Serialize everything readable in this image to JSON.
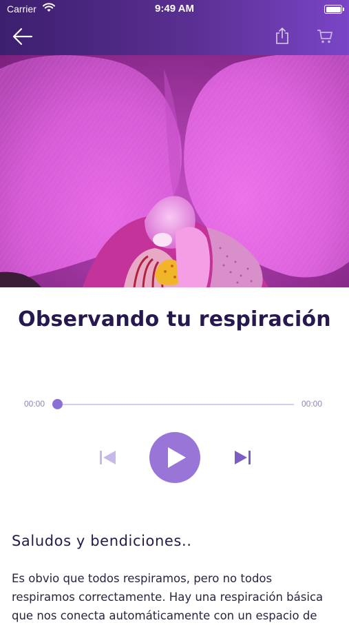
{
  "status_bar": {
    "carrier": "Carrier",
    "time": "9:49 AM"
  },
  "nav": {
    "back_icon": "arrow-left-icon",
    "share_icon": "share-icon",
    "cart_icon": "cart-icon"
  },
  "hero": {
    "subject": "pink orchid close-up"
  },
  "title": "Observando tu respiración",
  "player": {
    "elapsed": "00:00",
    "duration": "00:00",
    "progress": 0,
    "accent_color": "#9a75d8"
  },
  "content": {
    "greeting": "Saludos y bendiciones..",
    "paragraph_lines": [
      "Es obvio que todos respiramos, pero no todos",
      "respiramos correctamente.  Hay una respiración básica",
      "que nos conecta automáticamente con un espacio de"
    ]
  }
}
